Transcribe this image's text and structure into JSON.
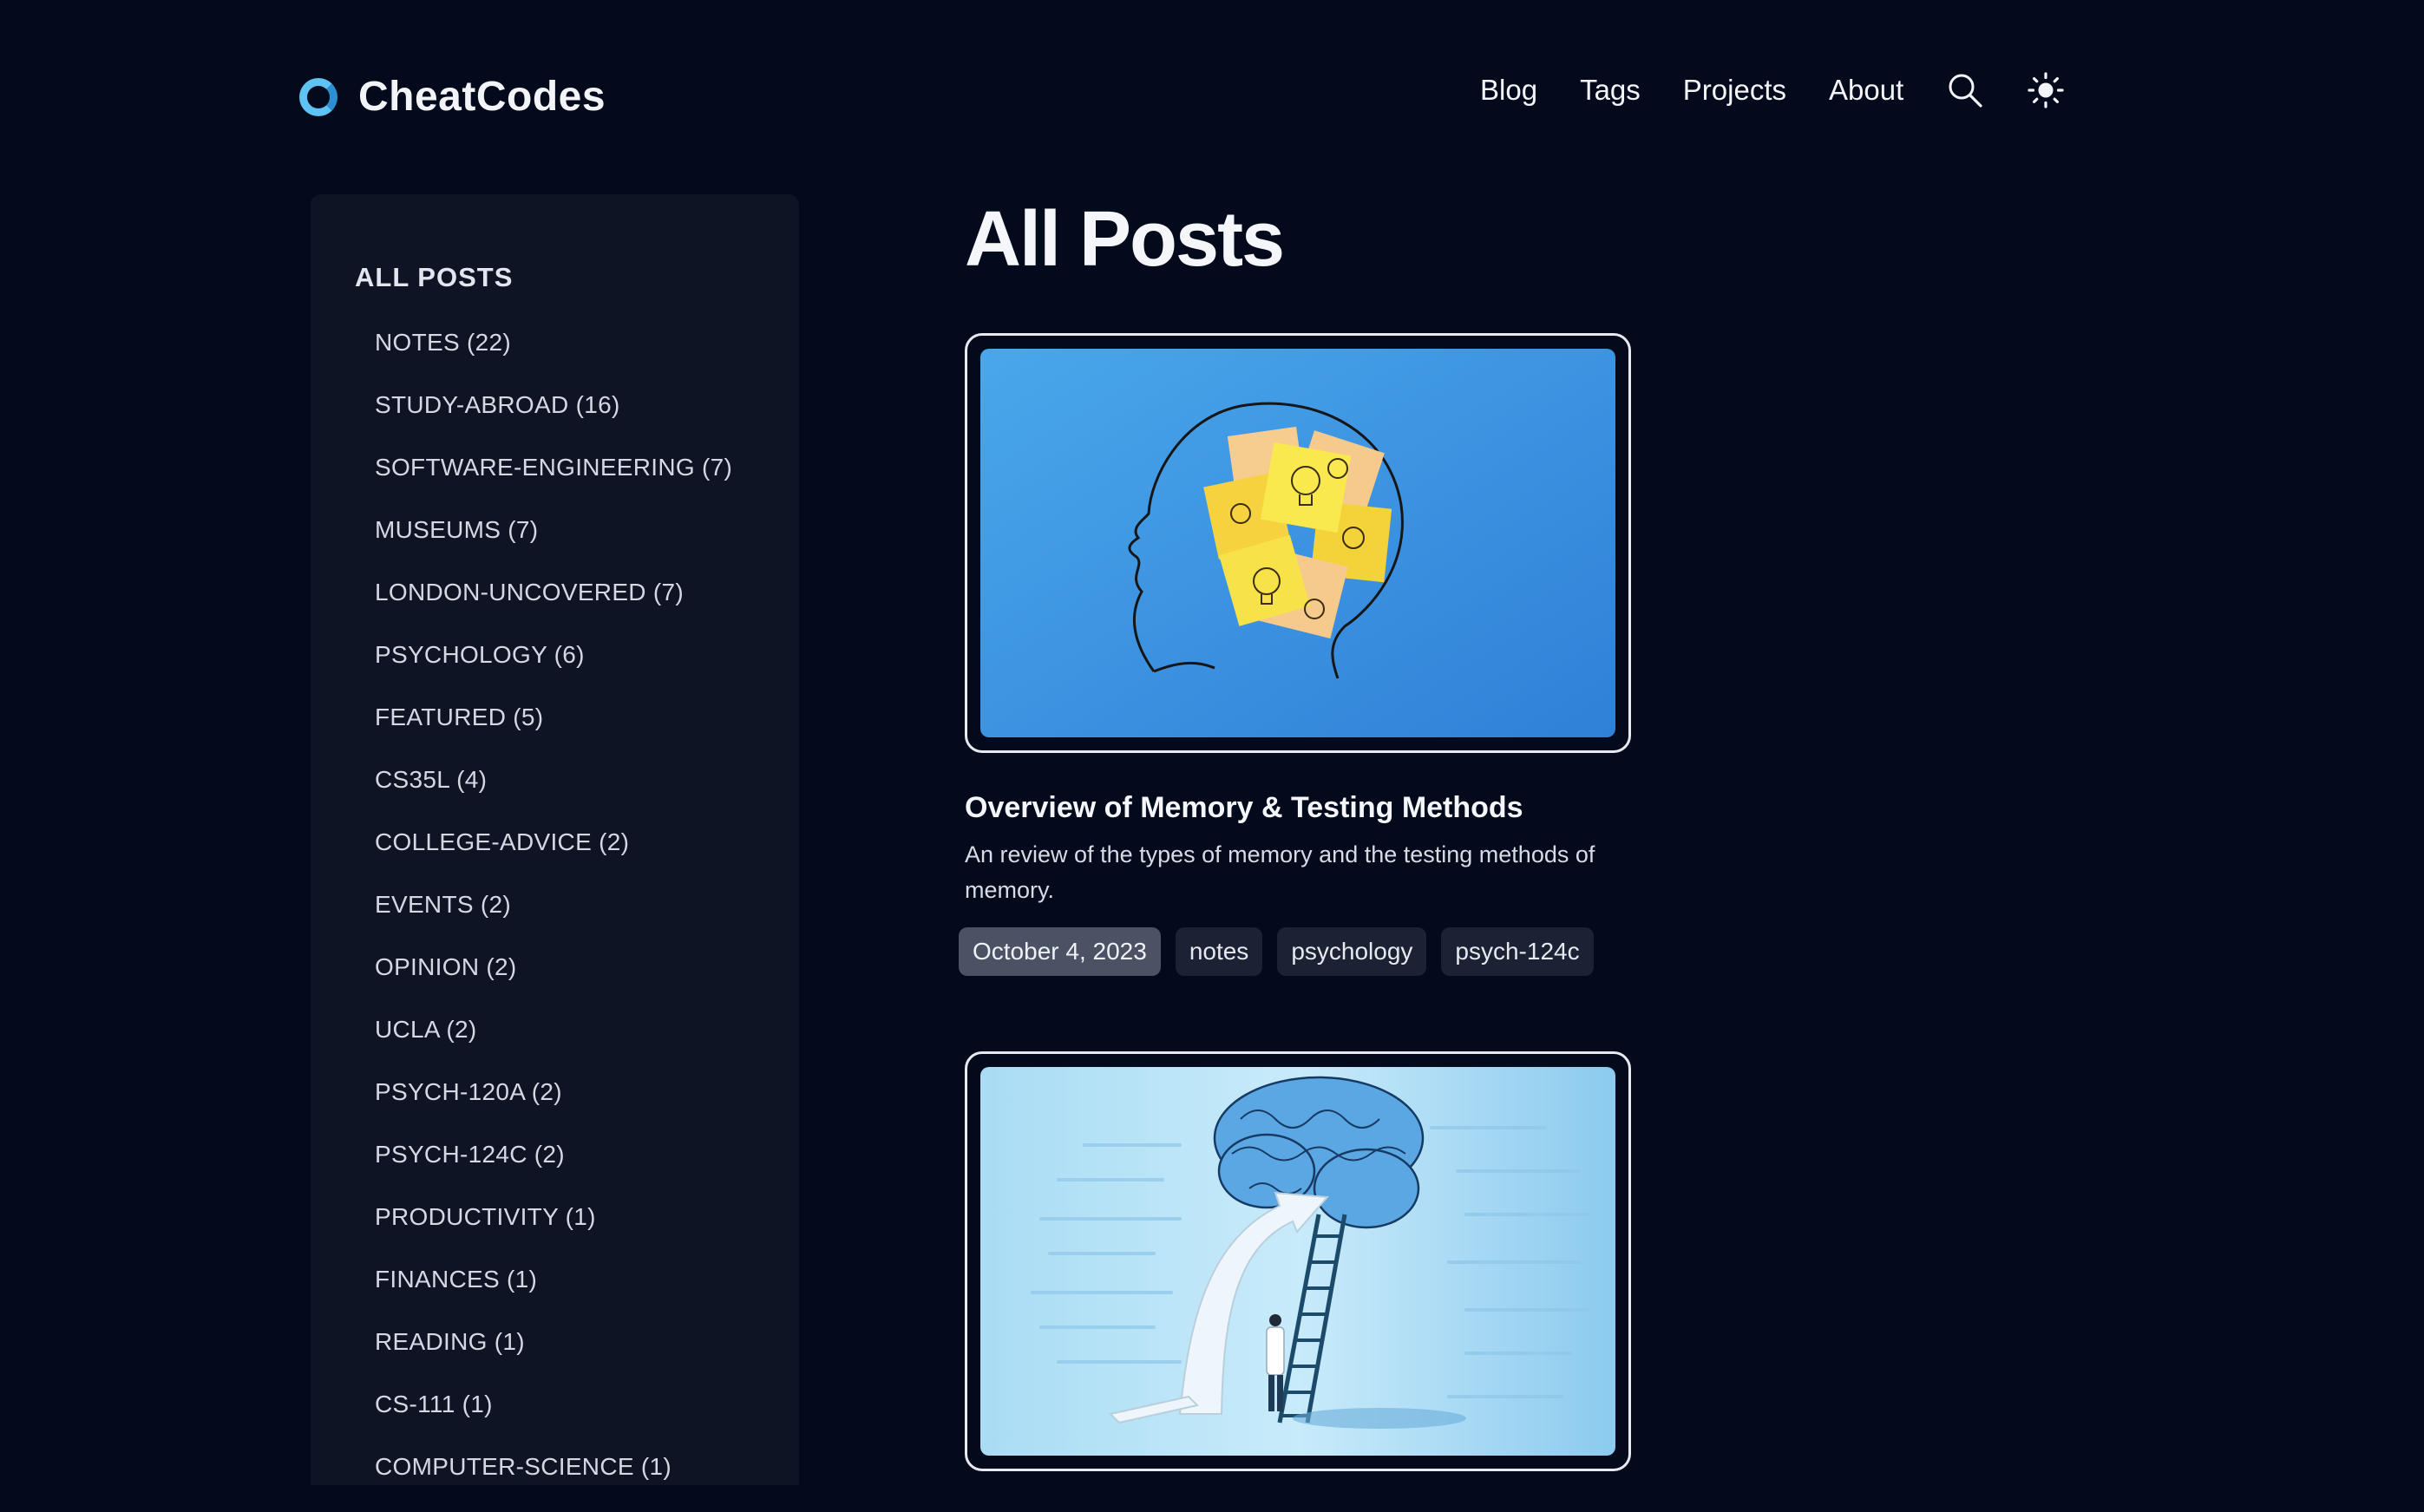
{
  "brand": {
    "name": "CheatCodes",
    "ring_color": "#5ec3f2"
  },
  "nav": {
    "links": [
      "Blog",
      "Tags",
      "Projects",
      "About"
    ],
    "search_icon": "search-icon",
    "theme_icon": "sun-icon"
  },
  "sidebar": {
    "heading": "ALL POSTS",
    "items": [
      {
        "label": "NOTES (22)"
      },
      {
        "label": "STUDY-ABROAD (16)"
      },
      {
        "label": "SOFTWARE-ENGINEERING (7)"
      },
      {
        "label": "MUSEUMS (7)"
      },
      {
        "label": "LONDON-UNCOVERED (7)"
      },
      {
        "label": "PSYCHOLOGY (6)"
      },
      {
        "label": "FEATURED (5)"
      },
      {
        "label": "CS35L (4)"
      },
      {
        "label": "COLLEGE-ADVICE (2)"
      },
      {
        "label": "EVENTS (2)"
      },
      {
        "label": "OPINION (2)"
      },
      {
        "label": "UCLA (2)"
      },
      {
        "label": "PSYCH-120A (2)"
      },
      {
        "label": "PSYCH-124C (2)"
      },
      {
        "label": "PRODUCTIVITY (1)"
      },
      {
        "label": "FINANCES (1)"
      },
      {
        "label": "READING (1)"
      },
      {
        "label": "CS-111 (1)"
      },
      {
        "label": "COMPUTER-SCIENCE (1)"
      }
    ]
  },
  "main": {
    "title": "All Posts",
    "posts": [
      {
        "title": "Overview of Memory & Testing Methods",
        "description": "An review of the types of memory and the testing methods of memory.",
        "date": "October 4, 2023",
        "tags": [
          "notes",
          "psychology",
          "psych-124c"
        ],
        "image": "head-with-lightbulb-sticky-notes-illustration"
      },
      {
        "image": "brain-with-ladder-illustration"
      }
    ]
  },
  "colors": {
    "background": "#030a1c",
    "sidebar": "#0e1424",
    "chip": "#1b2233",
    "date_chip": "#4a5264",
    "image_blue": "#3f9ae6",
    "image_light_blue": "#9fd3f1"
  }
}
